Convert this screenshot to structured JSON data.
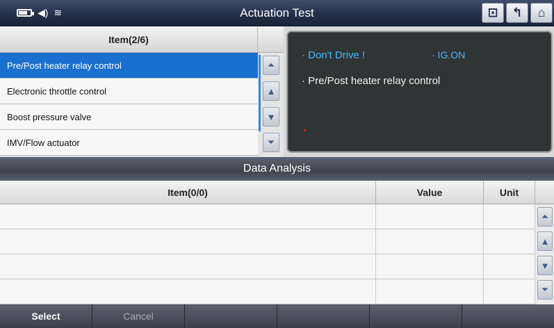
{
  "window": {
    "title": "Actuation Test"
  },
  "status_icons": [
    "battery-icon",
    "speaker-icon",
    "wifi-icon"
  ],
  "title_buttons": [
    {
      "icon": "vci-icon",
      "glyph": "⊡"
    },
    {
      "icon": "back-arrow-icon",
      "glyph": "↰"
    },
    {
      "icon": "home-icon",
      "glyph": "⌂"
    }
  ],
  "actuation_list": {
    "header": "Item(2/6)",
    "items": [
      "Pre/Post heater relay control",
      "Electronic throttle control",
      "Boost pressure valve",
      "IMV/Flow actuator"
    ],
    "selected_index": 0
  },
  "message": {
    "warning": "· Don't Drive !",
    "condition": "· IG.ON",
    "item": "· Pre/Post heater relay control"
  },
  "data_analysis": {
    "title": "Data Analysis",
    "columns": {
      "item": "Item(0/0)",
      "value": "Value",
      "unit": "Unit"
    },
    "rows": [
      [
        "",
        "",
        ""
      ],
      [
        "",
        "",
        ""
      ],
      [
        "",
        "",
        ""
      ],
      [
        "",
        "",
        ""
      ]
    ]
  },
  "bottom_bar": {
    "buttons": [
      "Select",
      "Cancel",
      "",
      "",
      "",
      ""
    ]
  },
  "colors": {
    "selection": "#1b6fd0",
    "accent_text": "#49b8ff",
    "titlebar": "#24304a"
  }
}
